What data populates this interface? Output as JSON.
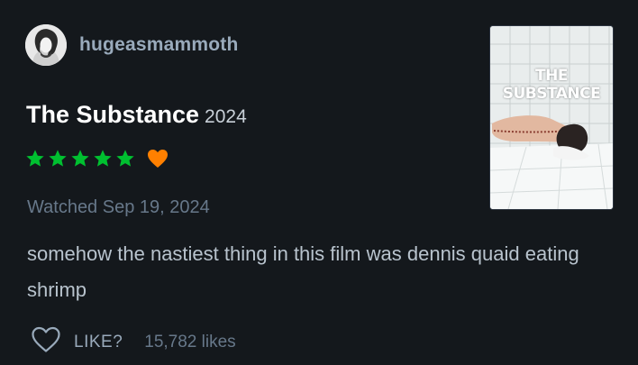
{
  "review": {
    "username": "hugeasmammoth",
    "film_title": "The Substance",
    "film_year": "2024",
    "rating_stars": 5,
    "liked": true,
    "watched_text": "Watched Sep 19, 2024",
    "body": "somehow the nastiest thing in this film was dennis quaid eating shrimp",
    "like_label": "LIKE?",
    "likes_count": "15,782 likes",
    "poster_title": "THE SUBSTANCE"
  },
  "colors": {
    "background": "#14181c",
    "star": "#00c030",
    "heart": "#ff8000",
    "muted": "#67788a",
    "username": "#99aabb"
  },
  "icons": {
    "avatar": "user-avatar",
    "star": "star-icon",
    "heart": "heart-icon",
    "like": "heart-outline-icon"
  }
}
